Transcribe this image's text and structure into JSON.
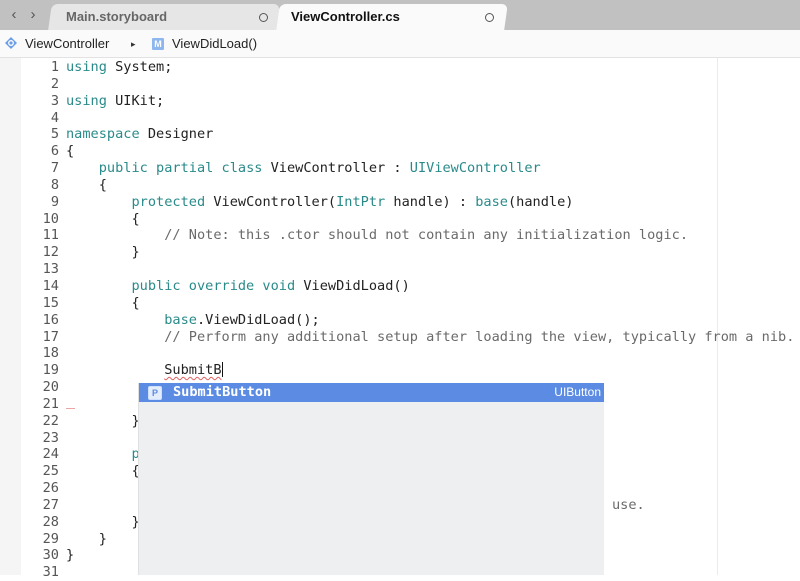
{
  "tabs": [
    {
      "label": "Main.storyboard",
      "active": false
    },
    {
      "label": "ViewController.cs",
      "active": true
    }
  ],
  "nav": {
    "back_icon": "‹",
    "forward_icon": "›"
  },
  "breadcrumb": {
    "class_name": "ViewController",
    "separator": "▸",
    "method_icon_letter": "M",
    "method_name": "ViewDidLoad()"
  },
  "editor": {
    "lines": [
      {
        "n": "1"
      },
      {
        "n": "2"
      },
      {
        "n": "3"
      },
      {
        "n": "4"
      },
      {
        "n": "5"
      },
      {
        "n": "6"
      },
      {
        "n": "7"
      },
      {
        "n": "8"
      },
      {
        "n": "9"
      },
      {
        "n": "10"
      },
      {
        "n": "11"
      },
      {
        "n": "12"
      },
      {
        "n": "13"
      },
      {
        "n": "14"
      },
      {
        "n": "15"
      },
      {
        "n": "16"
      },
      {
        "n": "17"
      },
      {
        "n": "18"
      },
      {
        "n": "19"
      },
      {
        "n": "20"
      },
      {
        "n": "21"
      },
      {
        "n": "22"
      },
      {
        "n": "23"
      },
      {
        "n": "24"
      },
      {
        "n": "25"
      },
      {
        "n": "26"
      },
      {
        "n": "27"
      },
      {
        "n": "28"
      },
      {
        "n": "29"
      },
      {
        "n": "30"
      },
      {
        "n": "31"
      }
    ],
    "code": {
      "l1_kw": "using",
      "l1_rest": " System;",
      "l3_kw": "using",
      "l3_rest": " UIKit;",
      "l5_kw": "namespace",
      "l5_rest": " Designer",
      "l6": "{",
      "l7_indent": "    ",
      "l7_kw": "public partial class",
      "l7_name": " ViewController : ",
      "l7_base": "UIViewController",
      "l8": "    {",
      "l9_indent": "        ",
      "l9_kw": "protected",
      "l9_a": " ViewController(",
      "l9_type": "IntPtr",
      "l9_b": " handle) : ",
      "l9_base": "base",
      "l9_c": "(handle)",
      "l10": "        {",
      "l11_indent": "            ",
      "l11_comment": "// Note: this .ctor should not contain any initialization logic.",
      "l12": "        }",
      "l14_indent": "        ",
      "l14_kw": "public override void",
      "l14_rest": " ViewDidLoad()",
      "l15": "        {",
      "l16_indent": "            ",
      "l16_base": "base",
      "l16_rest": ".ViewDidLoad();",
      "l17_indent": "            ",
      "l17_comment": "// Perform any additional setup after loading the view, typically from a nib.",
      "l19_indent": "            ",
      "l19_typed": "SubmitB",
      "l22": "        }",
      "l24_indent": "        ",
      "l24_kw": "p",
      "l25": "        {",
      "l27_tail": "use.",
      "l28": "        }",
      "l29": "    }",
      "l30": "}"
    }
  },
  "autocomplete": {
    "items": [
      {
        "kind_icon": "P",
        "name": "SubmitButton",
        "type": "UIButton",
        "selected": true
      }
    ]
  },
  "colors": {
    "keyword": "#2a8a8a",
    "comment": "#6a6a6a",
    "selection": "#5b8be3",
    "tabbar": "#c1c1c1"
  }
}
